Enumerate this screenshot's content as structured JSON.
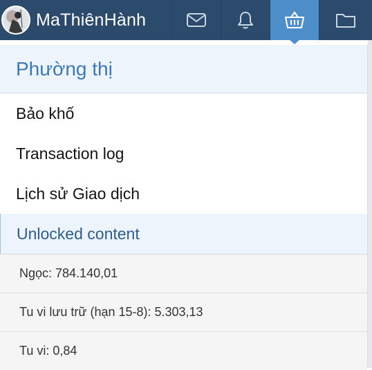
{
  "topbar": {
    "username": "MaThiênHành",
    "nav": [
      {
        "icon": "envelope-icon",
        "active": false
      },
      {
        "icon": "bell-icon",
        "active": false
      },
      {
        "icon": "basket-icon",
        "active": true
      },
      {
        "icon": "folder-icon",
        "active": false
      }
    ],
    "colors": {
      "bar": "#2b4a6c",
      "active": "#4e8fc9"
    }
  },
  "panel": {
    "title": "Phường thị",
    "menu": [
      {
        "label": "Bảo khố"
      },
      {
        "label": "Transaction log"
      },
      {
        "label": "Lịch sử Giao dịch"
      },
      {
        "label": "Unlocked content",
        "selected": true
      }
    ],
    "stats": [
      {
        "text": "Ngọc: 784.140,01"
      },
      {
        "text": "Tu vi lưu trữ (hạn 15-8): 5.303,13"
      },
      {
        "text": "Tu vi: 0,84"
      }
    ]
  }
}
